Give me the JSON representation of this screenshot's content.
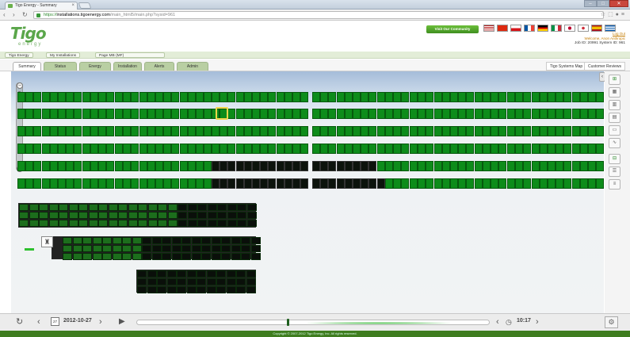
{
  "browser": {
    "tab_title": "Tigo Energy - Summary",
    "url_scheme": "https://",
    "url_domain": "installations.tigoenergy.com",
    "url_path": "/main_html5/main.php?sysid=961",
    "back_icon": "back-arrow-icon",
    "forward_icon": "forward-arrow-icon",
    "reload_icon": "reload-icon"
  },
  "header": {
    "logo_text": "Tigo",
    "logo_sub": "energy",
    "community_button": "Visit Our Community",
    "logout": "Log Out",
    "welcome": "Welcome, Anon Anthropic",
    "ids": "Job ID: 20991  System ID: 961"
  },
  "breadcrumb": [
    "Tigo Energy",
    "My Installations",
    "Page MB (MF)"
  ],
  "tabs": [
    "Summary",
    "Status",
    "Energy",
    "Installation",
    "Alerts",
    "Admin"
  ],
  "right_links": [
    "Tigo Systems Map",
    "Customer Reviews"
  ],
  "colors": {
    "module_green": "#0d8c1a",
    "module_dark": "#0c130c",
    "brand_green": "#5aa64a",
    "highlight": "#f0d64a"
  },
  "rows": [
    {
      "green": 48,
      "dark": 0
    },
    {
      "green": 48,
      "dark": 0
    },
    {
      "green": 48,
      "dark": 0
    },
    {
      "green": 48,
      "dark": 0
    },
    {
      "green": 24,
      "dark": 20,
      "green_after": 4
    },
    {
      "green": 24,
      "dark": 21,
      "green_after": 10
    }
  ],
  "bottom_bar": {
    "date": "2012-10-27",
    "time": "10:17",
    "refresh_icon": "refresh-icon",
    "calendar_icon": "calendar-icon",
    "play_icon": "play-icon",
    "clock_icon": "clock-icon",
    "settings_icon": "gear-icon"
  },
  "sidebar_icons": [
    "overview-icon",
    "grid-icon",
    "list-icon",
    "chart-icon",
    "report-icon",
    "wave-icon",
    "layout-icon",
    "table-icon",
    "menu-icon"
  ],
  "footer": "Copyright © 2007-2012 Tigo Energy, Inc. All rights reserved."
}
